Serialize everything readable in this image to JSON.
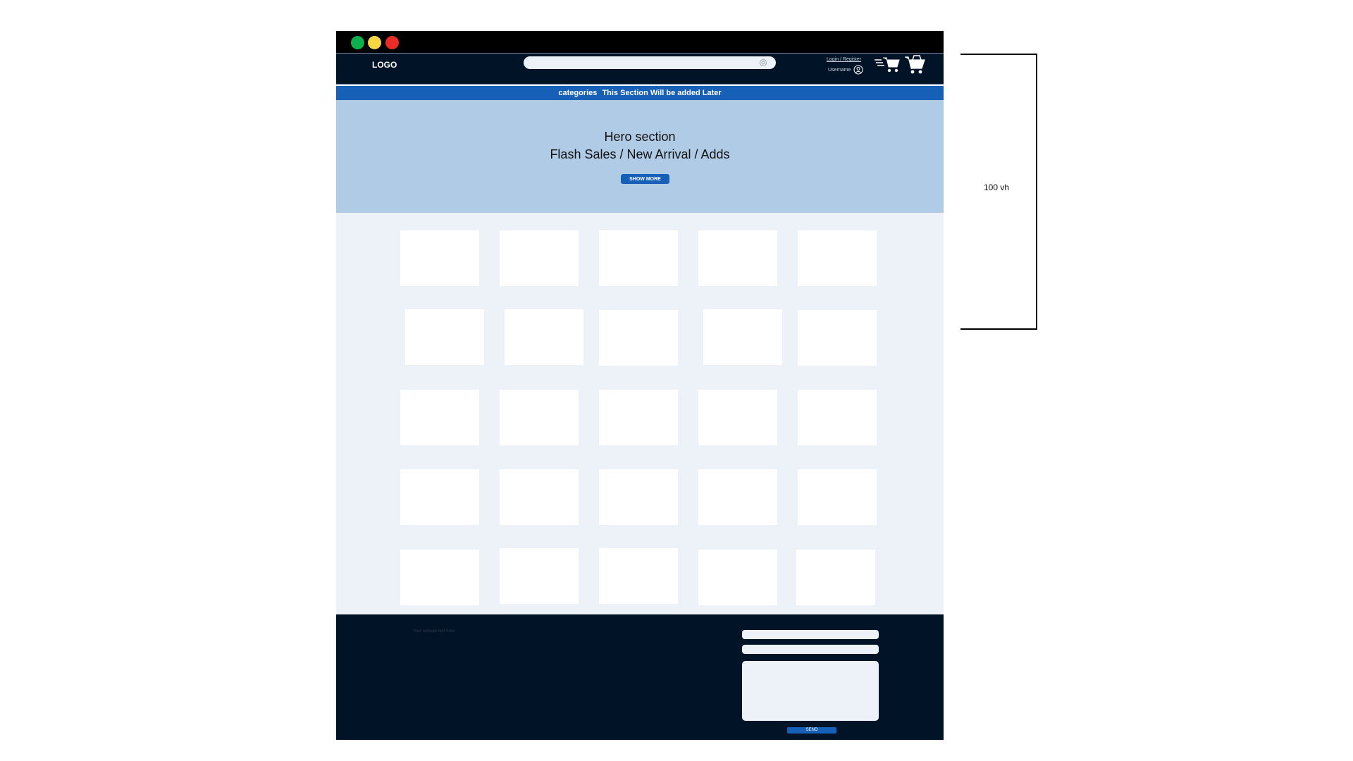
{
  "window": {
    "traffic_lights": [
      "green",
      "yellow",
      "red"
    ],
    "colors": {
      "green": "#0db14b",
      "yellow": "#f6d743",
      "red": "#ea2b27"
    }
  },
  "navbar": {
    "logo": "LOGO",
    "search": {
      "value": "",
      "placeholder": "",
      "icon": "search-icon"
    },
    "login_link": "Login / Register",
    "username": "Username",
    "icons": [
      "user-icon",
      "fast-cart-icon",
      "cart-icon"
    ]
  },
  "category_bar": {
    "label": "categories",
    "note": "This Section Will be added Later"
  },
  "hero": {
    "line1": "Hero section",
    "line2": "Flash Sales / New Arrival / Adds",
    "button": "SHOW MORE"
  },
  "products": {
    "rows": 5,
    "columns": 5,
    "count": 25
  },
  "footer": {
    "text": "Your website text here",
    "fields": [
      {
        "value": "",
        "placeholder": ""
      },
      {
        "value": "",
        "placeholder": ""
      }
    ],
    "message": {
      "value": "",
      "placeholder": ""
    },
    "send_button": "SEND"
  },
  "annotation": {
    "label": "100 vh"
  },
  "colors": {
    "dark_navy": "#011427",
    "accent_blue": "#1760b7",
    "hero_blue": "#b0cbe6",
    "page_bg": "#edf2f8"
  }
}
